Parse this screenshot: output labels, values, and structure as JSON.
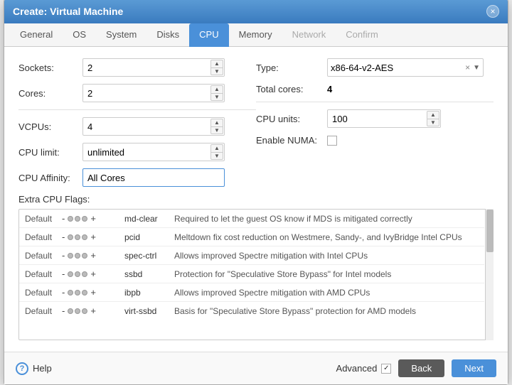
{
  "dialog": {
    "title": "Create: Virtual Machine",
    "close_label": "×"
  },
  "tabs": [
    {
      "id": "general",
      "label": "General",
      "active": false,
      "disabled": false
    },
    {
      "id": "os",
      "label": "OS",
      "active": false,
      "disabled": false
    },
    {
      "id": "system",
      "label": "System",
      "active": false,
      "disabled": false
    },
    {
      "id": "disks",
      "label": "Disks",
      "active": false,
      "disabled": false
    },
    {
      "id": "cpu",
      "label": "CPU",
      "active": true,
      "disabled": false
    },
    {
      "id": "memory",
      "label": "Memory",
      "active": false,
      "disabled": false
    },
    {
      "id": "network",
      "label": "Network",
      "active": false,
      "disabled": true
    },
    {
      "id": "confirm",
      "label": "Confirm",
      "active": false,
      "disabled": true
    }
  ],
  "left_fields": {
    "sockets_label": "Sockets:",
    "sockets_value": "2",
    "cores_label": "Cores:",
    "cores_value": "2",
    "vcpus_label": "VCPUs:",
    "vcpus_value": "4",
    "cpu_limit_label": "CPU limit:",
    "cpu_limit_value": "unlimited",
    "cpu_affinity_label": "CPU Affinity:",
    "cpu_affinity_value": "All Cores"
  },
  "right_fields": {
    "type_label": "Type:",
    "type_value": "x86-64-v2-AES",
    "total_cores_label": "Total cores:",
    "total_cores_value": "4",
    "cpu_units_label": "CPU units:",
    "cpu_units_value": "100",
    "enable_numa_label": "Enable NUMA:"
  },
  "extra_flags": {
    "section_label": "Extra CPU Flags:",
    "flags": [
      {
        "default": "Default",
        "name": "md-clear",
        "description": "Required to let the guest OS know if MDS is mitigated correctly"
      },
      {
        "default": "Default",
        "name": "pcid",
        "description": "Meltdown fix cost reduction on Westmere, Sandy-, and IvyBridge Intel CPUs"
      },
      {
        "default": "Default",
        "name": "spec-ctrl",
        "description": "Allows improved Spectre mitigation with Intel CPUs"
      },
      {
        "default": "Default",
        "name": "ssbd",
        "description": "Protection for \"Speculative Store Bypass\" for Intel models"
      },
      {
        "default": "Default",
        "name": "ibpb",
        "description": "Allows improved Spectre mitigation with AMD CPUs"
      },
      {
        "default": "Default",
        "name": "virt-ssbd",
        "description": "Basis for \"Speculative Store Bypass\" protection for AMD models"
      }
    ]
  },
  "footer": {
    "help_label": "Help",
    "advanced_label": "Advanced",
    "back_label": "Back",
    "next_label": "Next"
  }
}
